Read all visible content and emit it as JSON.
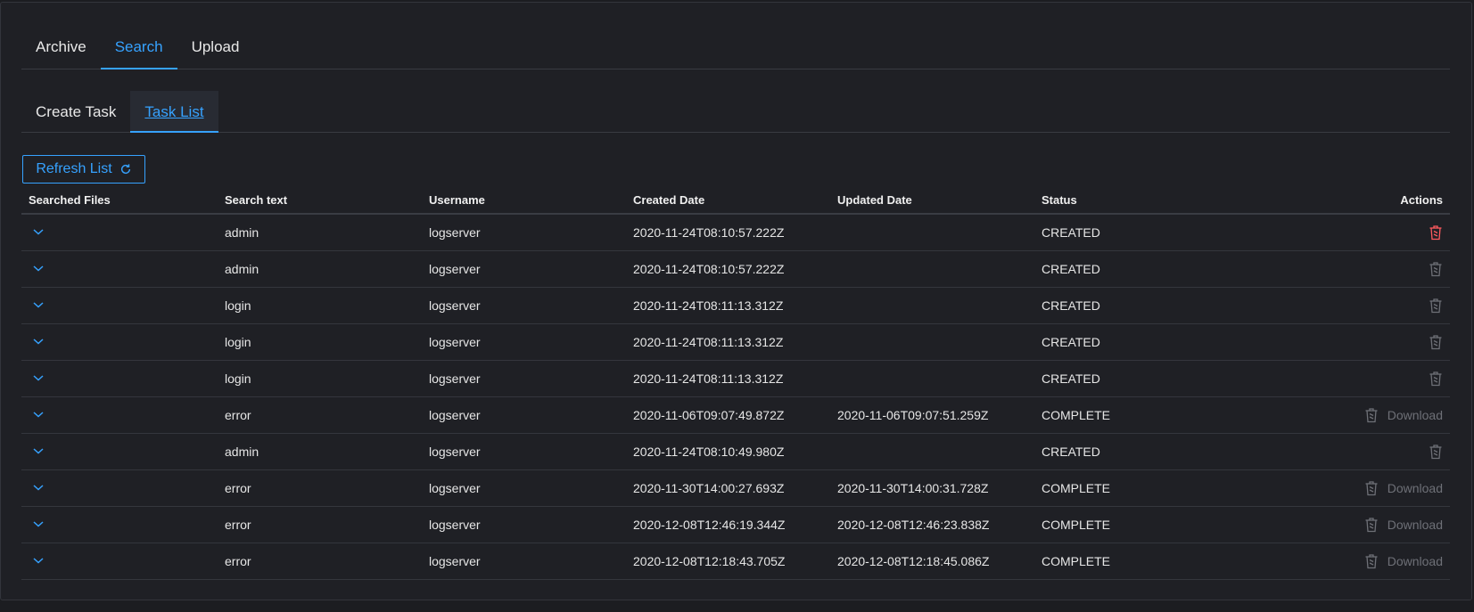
{
  "tabs_top": [
    "Archive",
    "Search",
    "Upload"
  ],
  "tabs_sub": [
    "Create Task",
    "Task List"
  ],
  "refresh_label": "Refresh List",
  "columns": [
    "Searched Files",
    "Search text",
    "Username",
    "Created Date",
    "Updated Date",
    "Status",
    "Actions"
  ],
  "download_label": "Download",
  "colors": {
    "accent": "#36a2ff",
    "danger": "#ff5a5f",
    "muted": "#6e7077"
  },
  "rows": [
    {
      "search": "admin",
      "user": "logserver",
      "created": "2020-11-24T08:10:57.222Z",
      "updated": "",
      "status": "CREATED",
      "download": false,
      "trash_color": "danger"
    },
    {
      "search": "admin",
      "user": "logserver",
      "created": "2020-11-24T08:10:57.222Z",
      "updated": "",
      "status": "CREATED",
      "download": false,
      "trash_color": "muted"
    },
    {
      "search": "login",
      "user": "logserver",
      "created": "2020-11-24T08:11:13.312Z",
      "updated": "",
      "status": "CREATED",
      "download": false,
      "trash_color": "muted"
    },
    {
      "search": "login",
      "user": "logserver",
      "created": "2020-11-24T08:11:13.312Z",
      "updated": "",
      "status": "CREATED",
      "download": false,
      "trash_color": "muted"
    },
    {
      "search": "login",
      "user": "logserver",
      "created": "2020-11-24T08:11:13.312Z",
      "updated": "",
      "status": "CREATED",
      "download": false,
      "trash_color": "muted"
    },
    {
      "search": "error",
      "user": "logserver",
      "created": "2020-11-06T09:07:49.872Z",
      "updated": "2020-11-06T09:07:51.259Z",
      "status": "COMPLETE",
      "download": true,
      "trash_color": "muted"
    },
    {
      "search": "admin",
      "user": "logserver",
      "created": "2020-11-24T08:10:49.980Z",
      "updated": "",
      "status": "CREATED",
      "download": false,
      "trash_color": "muted"
    },
    {
      "search": "error",
      "user": "logserver",
      "created": "2020-11-30T14:00:27.693Z",
      "updated": "2020-11-30T14:00:31.728Z",
      "status": "COMPLETE",
      "download": true,
      "trash_color": "muted"
    },
    {
      "search": "error",
      "user": "logserver",
      "created": "2020-12-08T12:46:19.344Z",
      "updated": "2020-12-08T12:46:23.838Z",
      "status": "COMPLETE",
      "download": true,
      "trash_color": "muted"
    },
    {
      "search": "error",
      "user": "logserver",
      "created": "2020-12-08T12:18:43.705Z",
      "updated": "2020-12-08T12:18:45.086Z",
      "status": "COMPLETE",
      "download": true,
      "trash_color": "muted"
    }
  ]
}
